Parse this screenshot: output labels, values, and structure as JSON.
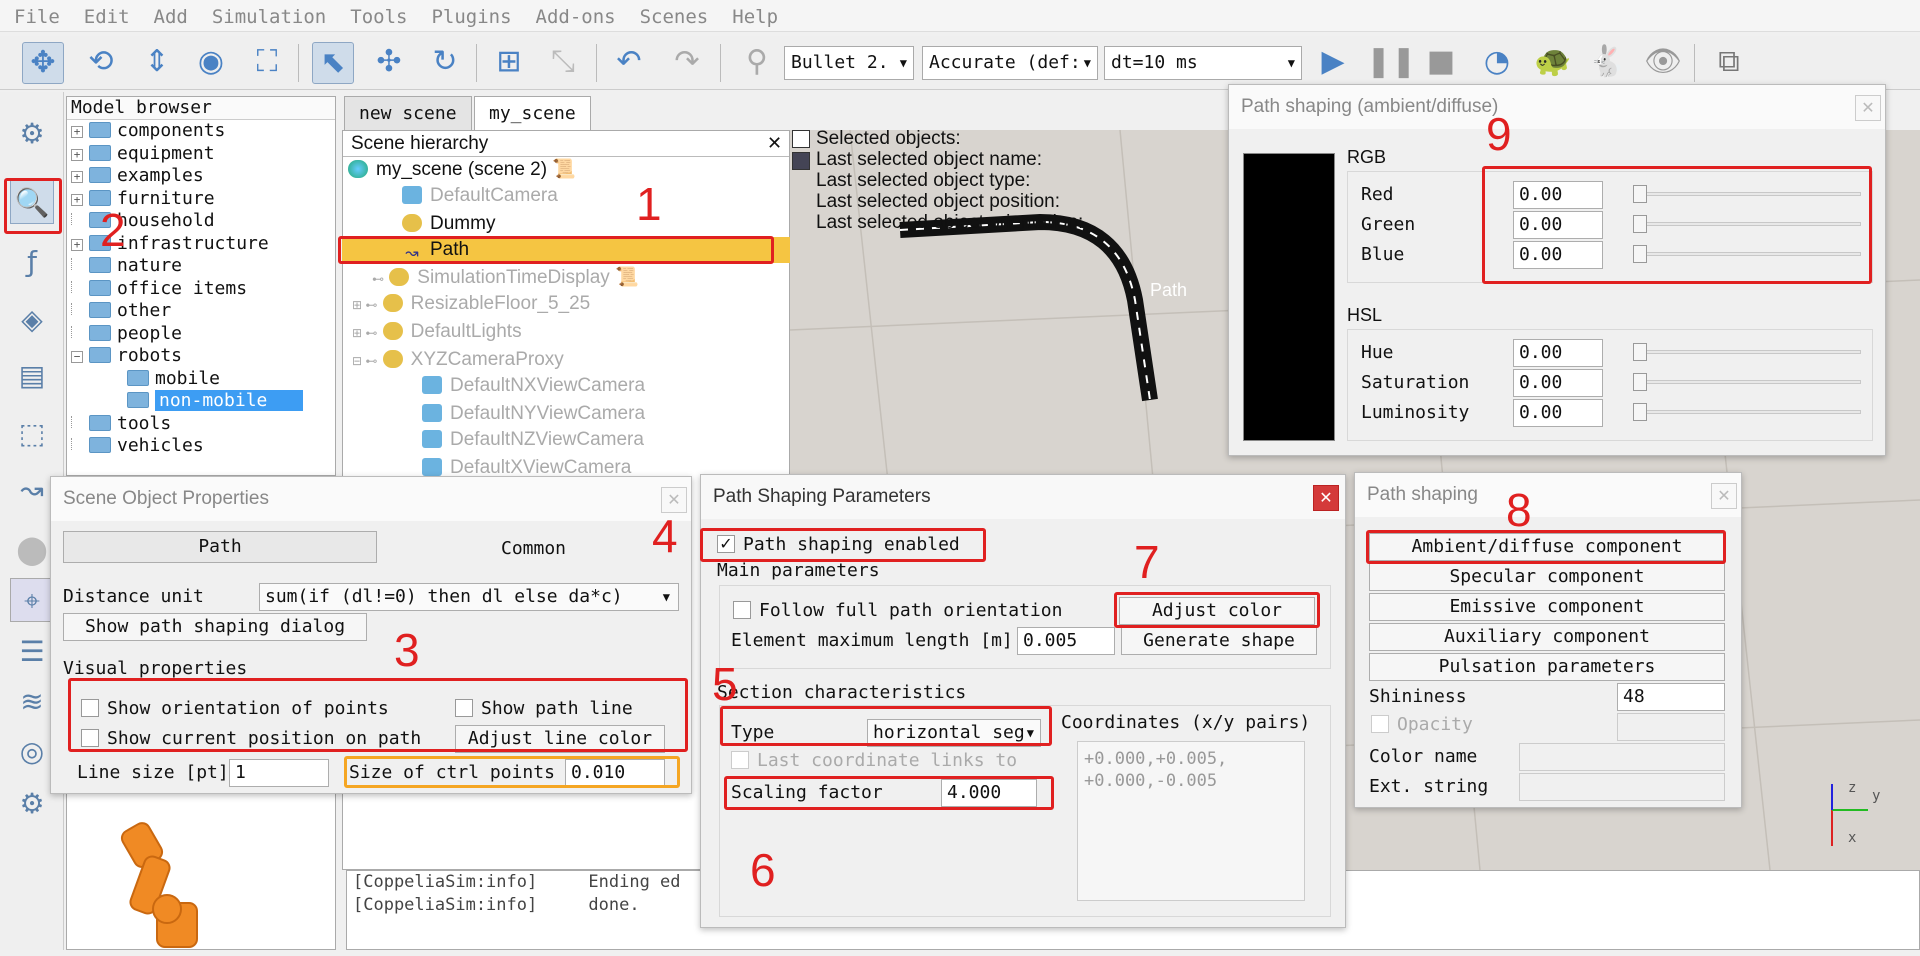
{
  "menu": [
    "File",
    "Edit",
    "Add",
    "Simulation",
    "Tools",
    "Plugins",
    "Add-ons",
    "Scenes",
    "Help"
  ],
  "toolbar": {
    "engine": "Bullet 2.",
    "accuracy": "Accurate (def:",
    "dt": "dt=10 ms"
  },
  "model_browser": {
    "title": "Model browser",
    "items": [
      {
        "label": "components",
        "expandable": true
      },
      {
        "label": "equipment",
        "expandable": true
      },
      {
        "label": "examples",
        "expandable": true
      },
      {
        "label": "furniture",
        "expandable": true
      },
      {
        "label": "household",
        "expandable": false
      },
      {
        "label": "infrastructure",
        "expandable": true
      },
      {
        "label": "nature",
        "expandable": false
      },
      {
        "label": "office items",
        "expandable": false
      },
      {
        "label": "other",
        "expandable": false
      },
      {
        "label": "people",
        "expandable": false
      },
      {
        "label": "robots",
        "expandable": true
      },
      {
        "label": "mobile",
        "child": true
      },
      {
        "label": "non-mobile",
        "child": true,
        "selected": true
      },
      {
        "label": "tools",
        "expandable": false
      },
      {
        "label": "vehicles",
        "expandable": false
      }
    ]
  },
  "tabs": [
    "new scene",
    "my_scene"
  ],
  "hierarchy": {
    "title": "Scene hierarchy",
    "root": "my_scene (scene 2)",
    "items": [
      "DefaultCamera",
      "Dummy",
      "Path",
      "SimulationTimeDisplay",
      "ResizableFloor_5_25",
      "DefaultLights",
      "XYZCameraProxy",
      "DefaultNXViewCamera",
      "DefaultNYViewCamera",
      "DefaultNZViewCamera",
      "DefaultXViewCamera"
    ]
  },
  "overlay_info": [
    "Selected objects:",
    "Last selected object name:",
    "Last selected object type:",
    "Last selected object position:",
    "Last selected object orientation:"
  ],
  "path_label": "Path",
  "scene_props": {
    "title": "Scene Object Properties",
    "tab_path": "Path",
    "tab_common": "Common",
    "distance_unit_label": "Distance unit",
    "distance_unit_value": "sum(if (dl!=0) then dl else da*c)",
    "show_dialog_btn": "Show path shaping dialog",
    "visual_props": "Visual properties",
    "show_orientation": "Show orientation of points",
    "show_path_line": "Show path line",
    "show_current_pos": "Show current position on path",
    "adjust_line_color": "Adjust line color",
    "line_size_label": "Line size [pt]",
    "line_size_value": "1",
    "ctrl_size_label": "Size of ctrl points",
    "ctrl_size_value": "0.010"
  },
  "psp": {
    "title": "Path Shaping Parameters",
    "enabled_label": "Path shaping enabled",
    "main_params": "Main parameters",
    "follow_label": "Follow full path orientation",
    "adjust_color": "Adjust color",
    "max_len_label": "Element maximum length [m]",
    "max_len_value": "0.005",
    "generate_shape": "Generate shape",
    "section_chars": "Section characteristics",
    "type_label": "Type",
    "type_value": "horizontal seg",
    "last_coord": "Last coordinate links to fi",
    "scaling_label": "Scaling factor",
    "scaling_value": "4.000",
    "coords_label": "Coordinates (x/y pairs)",
    "coords_text": [
      "+0.000,+0.005,",
      "+0.000,-0.005"
    ]
  },
  "color_dlg": {
    "title": "Path shaping (ambient/diffuse)",
    "rgb": "RGB",
    "hsl": "HSL",
    "swatch_color": "#000000",
    "rgb_rows": [
      {
        "label": "Red",
        "value": "0.00"
      },
      {
        "label": "Green",
        "value": "0.00"
      },
      {
        "label": "Blue",
        "value": "0.00"
      }
    ],
    "hsl_rows": [
      {
        "label": "Hue",
        "value": "0.00"
      },
      {
        "label": "Saturation",
        "value": "0.00"
      },
      {
        "label": "Luminosity",
        "value": "0.00"
      }
    ]
  },
  "shaping_dlg": {
    "title": "Path shaping",
    "buttons": [
      "Ambient/diffuse component",
      "Specular component",
      "Emissive component",
      "Auxiliary component",
      "Pulsation parameters"
    ],
    "shininess_label": "Shininess",
    "shininess_value": "48",
    "opacity_label": "Opacity",
    "color_name_label": "Color name",
    "ext_string_label": "Ext. string"
  },
  "console": [
    "[CoppeliaSim:info]     Ending ed",
    "[CoppeliaSim:info]     done."
  ],
  "annotations": [
    "1",
    "2",
    "3",
    "4",
    "5",
    "6",
    "7",
    "8",
    "9"
  ],
  "axis": {
    "z": "z",
    "y": "y",
    "x": "x"
  },
  "colors": {
    "accent": "#e02020",
    "highlight": "#f5a623",
    "selection": "#3d9df3"
  }
}
